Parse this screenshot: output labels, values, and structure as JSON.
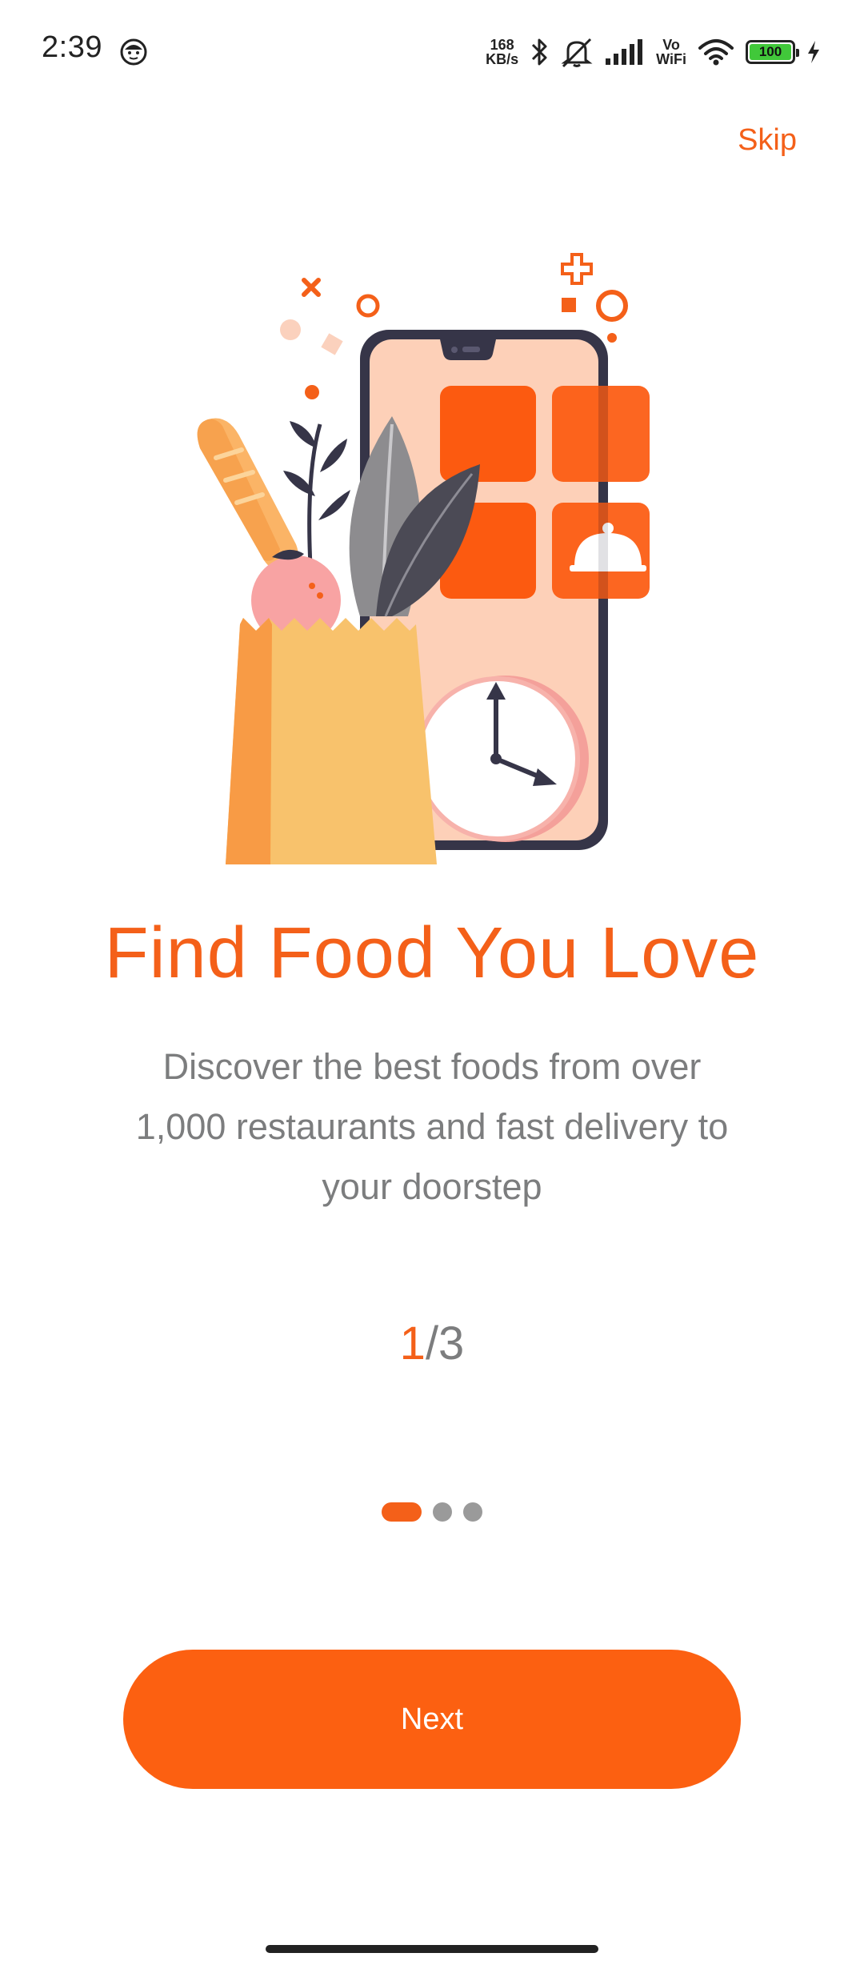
{
  "status_bar": {
    "time": "2:39",
    "net_speed_value": "168",
    "net_speed_unit": "KB/s",
    "vo_label": "Vo",
    "wifi_label": "WiFi",
    "battery_level": "100"
  },
  "onboarding": {
    "skip_label": "Skip",
    "title": "Find Food You Love",
    "description": "Discover the best foods from over 1,000 restaurants and fast delivery to your doorstep",
    "page_current": "1",
    "page_total": "/3",
    "page_count": 3,
    "active_page_index": 0,
    "next_label": "Next"
  },
  "colors": {
    "accent": "#fc6011",
    "text_secondary": "#7c7d7e",
    "dot_inactive": "#9a9a9a"
  },
  "icons": [
    "face-icon",
    "bluetooth-icon",
    "mute-icon",
    "signal-icon",
    "wifi-icon",
    "battery-icon",
    "charging-icon"
  ]
}
